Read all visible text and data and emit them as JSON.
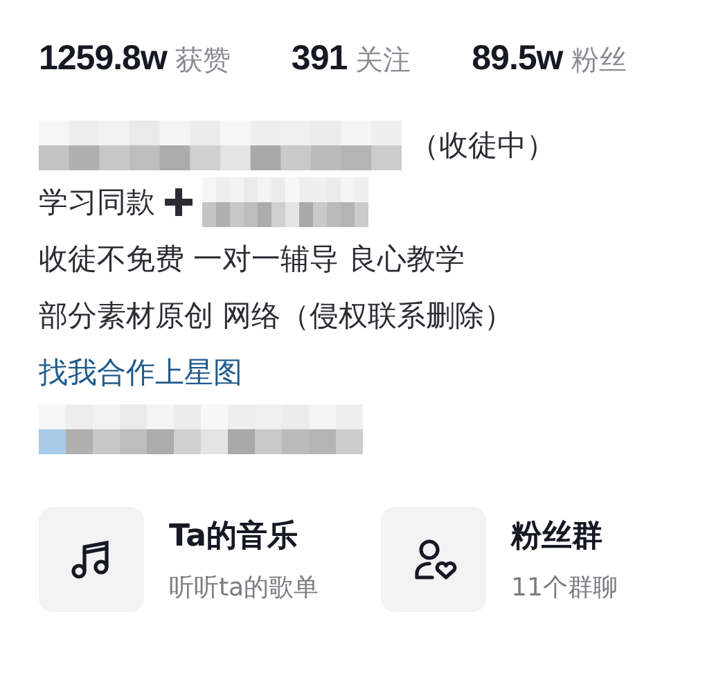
{
  "stats": [
    {
      "value": "1259.8w",
      "label": "获赞"
    },
    {
      "value": "391",
      "label": "关注"
    },
    {
      "value": "89.5w",
      "label": "粉丝"
    }
  ],
  "bio": [
    {
      "segments": [
        {
          "kind": "mosaic"
        },
        {
          "kind": "text",
          "text": "（收徒中）"
        }
      ]
    },
    {
      "segments": [
        {
          "kind": "text",
          "text": "学习同款"
        },
        {
          "kind": "plus"
        },
        {
          "kind": "mosaic"
        }
      ]
    },
    {
      "segments": [
        {
          "kind": "text",
          "text": "收徒不免费 一对一辅导 良心教学"
        }
      ]
    },
    {
      "segments": [
        {
          "kind": "text",
          "text": "部分素材原创 网络（侵权联系删除）"
        }
      ]
    },
    {
      "segments": [
        {
          "kind": "link",
          "text": "找我合作上星图"
        }
      ]
    },
    {
      "segments": [
        {
          "kind": "mosaic"
        }
      ]
    }
  ],
  "features": [
    {
      "kind": "music",
      "title": "Ta的音乐",
      "subtitle": "听听ta的歌单"
    },
    {
      "kind": "fans",
      "title": "粉丝群",
      "subtitle": "11个群聊"
    }
  ]
}
